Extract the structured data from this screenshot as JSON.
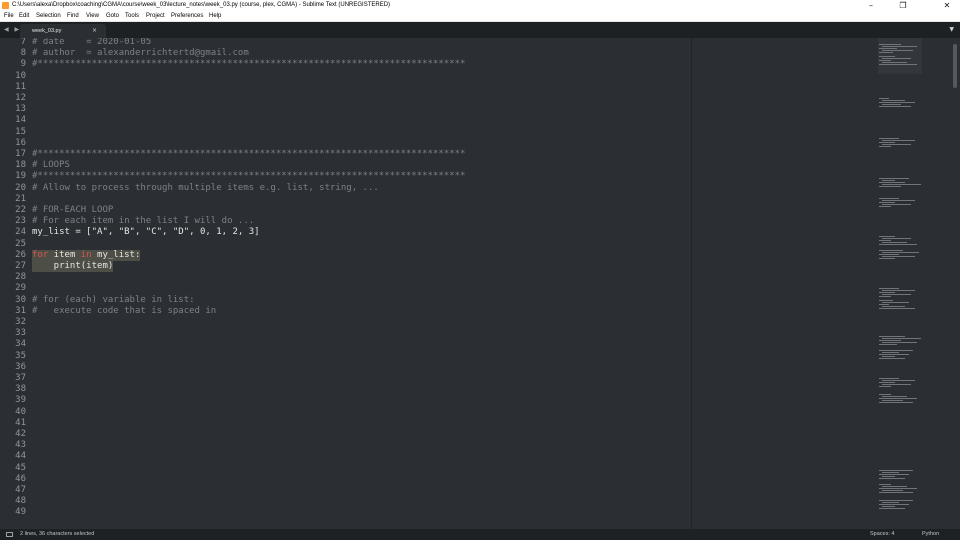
{
  "window": {
    "title": "C:\\Users\\alexa\\Dropbox\\coaching\\CGMA\\course\\week_03\\lecture_notes\\week_03.py (course, plex, CGMA) - Sublime Text (UNREGISTERED)",
    "minimize_glyph": "–",
    "maximize_glyph": "❐",
    "close_glyph": "✕"
  },
  "menu": [
    "File",
    "Edit",
    "Selection",
    "Find",
    "View",
    "Goto",
    "Tools",
    "Project",
    "Preferences",
    "Help"
  ],
  "tabs": {
    "nav_arrows": "◀ ▶",
    "active": {
      "label": "week_03.py",
      "close_glyph": "×"
    },
    "dropdown_glyph": "▼"
  },
  "editor": {
    "lines": [
      {
        "n": "7",
        "segments": [
          {
            "c": "cm",
            "t": "# date    = 2020-01-05"
          }
        ]
      },
      {
        "n": "8",
        "segments": [
          {
            "c": "cm",
            "t": "# author  = alexanderrichtertd@gmail.com"
          }
        ]
      },
      {
        "n": "9",
        "segments": [
          {
            "c": "cm",
            "t": "#*******************************************************************************"
          }
        ]
      },
      {
        "n": "10",
        "segments": []
      },
      {
        "n": "11",
        "segments": []
      },
      {
        "n": "12",
        "segments": []
      },
      {
        "n": "13",
        "segments": []
      },
      {
        "n": "14",
        "segments": []
      },
      {
        "n": "15",
        "segments": []
      },
      {
        "n": "16",
        "segments": []
      },
      {
        "n": "17",
        "segments": [
          {
            "c": "cm",
            "t": "#*******************************************************************************"
          }
        ]
      },
      {
        "n": "18",
        "segments": [
          {
            "c": "cm",
            "t": "# LOOPS"
          }
        ]
      },
      {
        "n": "19",
        "segments": [
          {
            "c": "cm",
            "t": "#*******************************************************************************"
          }
        ]
      },
      {
        "n": "20",
        "segments": [
          {
            "c": "cm",
            "t": "# Allow to process through multiple items e.g. list, string, ..."
          }
        ]
      },
      {
        "n": "21",
        "segments": []
      },
      {
        "n": "22",
        "segments": [
          {
            "c": "cm",
            "t": "# FOR-EACH LOOP"
          }
        ]
      },
      {
        "n": "23",
        "segments": [
          {
            "c": "cm",
            "t": "# For each item in the list I will do ..."
          }
        ]
      },
      {
        "n": "24",
        "segments": [
          {
            "c": "pl",
            "t": "my_list = [\"A\", \"B\", \"C\", \"D\", 0, 1, 2, 3]"
          }
        ]
      },
      {
        "n": "25",
        "segments": []
      },
      {
        "n": "26",
        "selected": true,
        "segments": [
          {
            "c": "kw",
            "t": "for"
          },
          {
            "c": "pl",
            "t": " item "
          },
          {
            "c": "kw",
            "t": "in"
          },
          {
            "c": "pl",
            "t": " my_list:"
          }
        ]
      },
      {
        "n": "27",
        "selected": true,
        "segments": [
          {
            "c": "pl",
            "t": "    print(item)"
          }
        ]
      },
      {
        "n": "28",
        "segments": []
      },
      {
        "n": "29",
        "segments": []
      },
      {
        "n": "30",
        "segments": [
          {
            "c": "cm",
            "t": "# for (each) variable in list:"
          }
        ]
      },
      {
        "n": "31",
        "segments": [
          {
            "c": "cm",
            "t": "#   execute code that is spaced in"
          }
        ]
      },
      {
        "n": "32",
        "segments": []
      },
      {
        "n": "33",
        "segments": []
      },
      {
        "n": "34",
        "segments": []
      },
      {
        "n": "35",
        "segments": []
      },
      {
        "n": "36",
        "segments": []
      },
      {
        "n": "37",
        "segments": []
      },
      {
        "n": "38",
        "segments": []
      },
      {
        "n": "39",
        "segments": []
      },
      {
        "n": "40",
        "segments": []
      },
      {
        "n": "41",
        "segments": []
      },
      {
        "n": "42",
        "segments": []
      },
      {
        "n": "43",
        "segments": []
      },
      {
        "n": "44",
        "segments": []
      },
      {
        "n": "45",
        "segments": []
      },
      {
        "n": "46",
        "segments": []
      },
      {
        "n": "47",
        "segments": []
      },
      {
        "n": "48",
        "segments": []
      },
      {
        "n": "49",
        "segments": []
      }
    ]
  },
  "status": {
    "selection": "2 lines, 36 characters selected",
    "indent": "Spaces: 4",
    "syntax": "Python"
  },
  "colors": {
    "background": "#2b2f33",
    "comment": "#7b8187",
    "keyword": "#d9534f",
    "plain": "#e6e6e6",
    "selection": "#4d4f47"
  }
}
